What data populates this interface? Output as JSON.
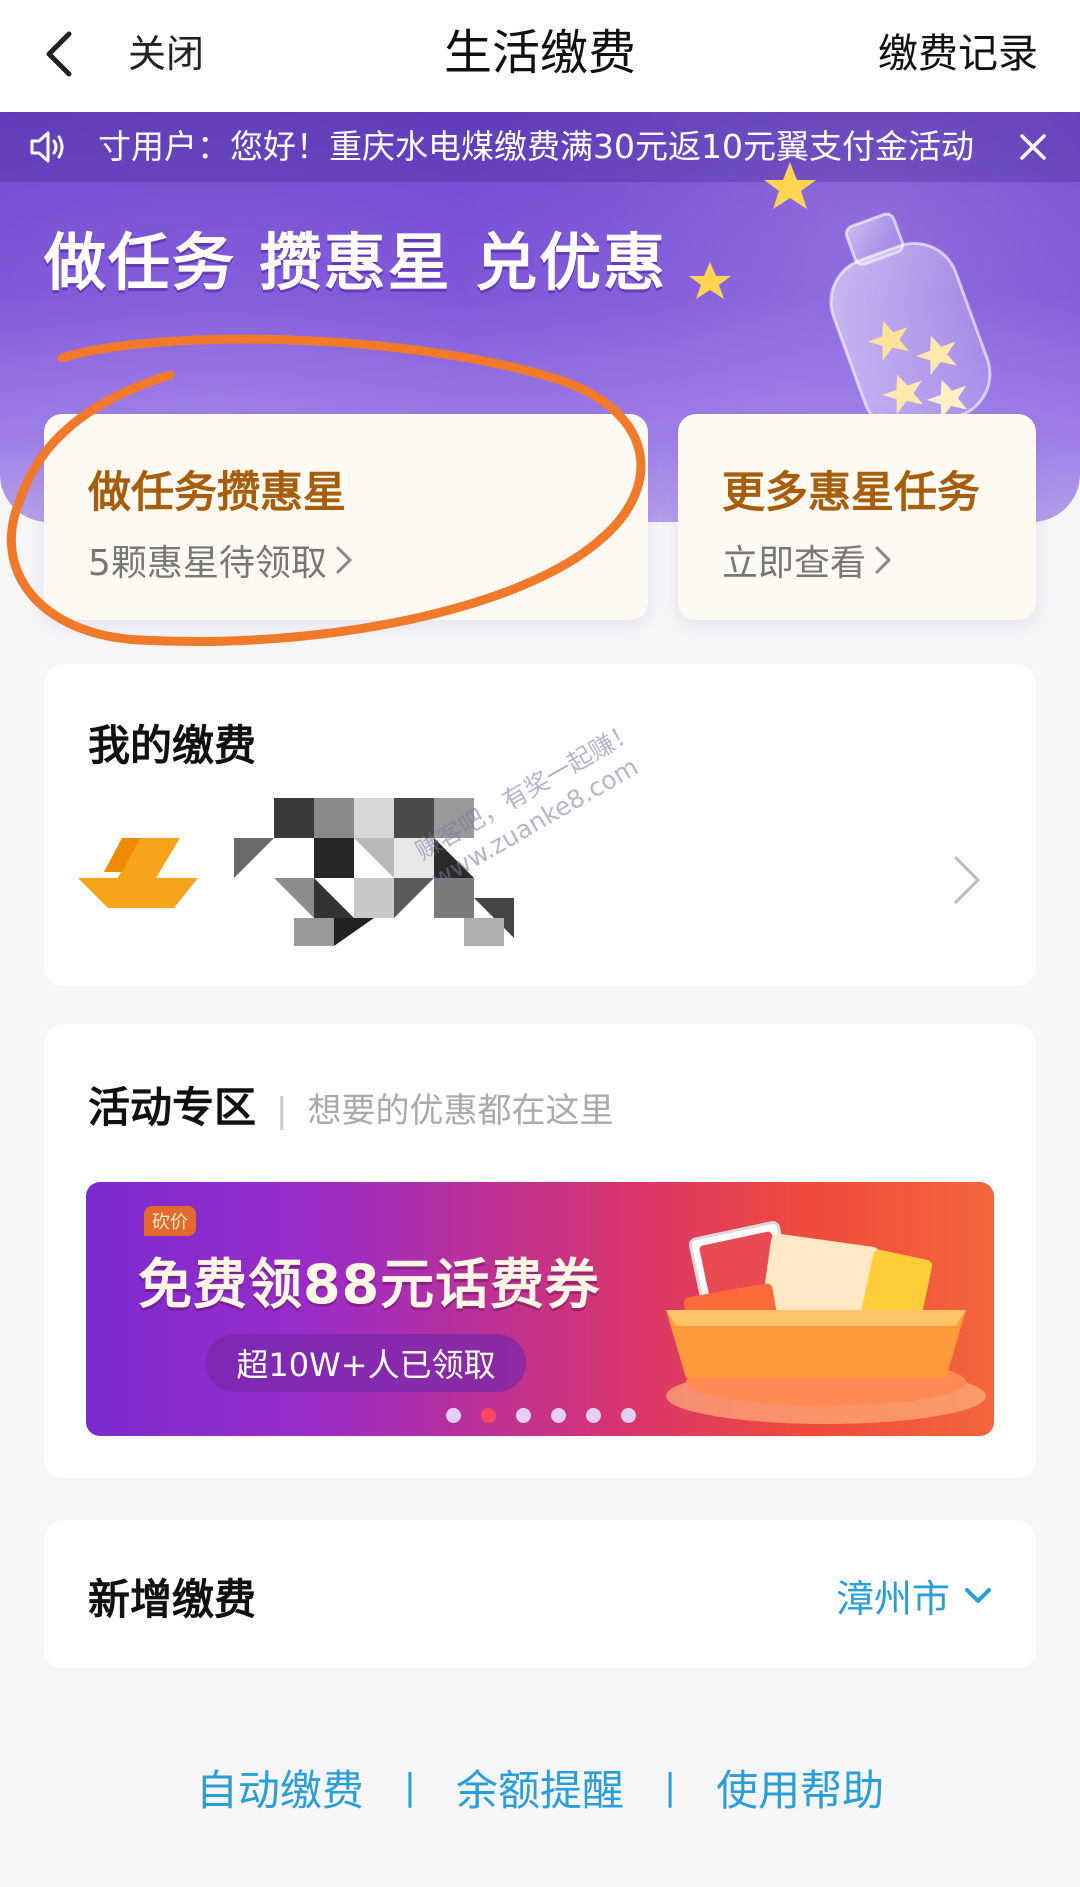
{
  "nav": {
    "back_icon": "chevron-left-icon",
    "close_label": "关闭",
    "title": "生活缴费",
    "records_label": "缴费记录"
  },
  "notice": {
    "icon": "speaker-icon",
    "text": "寸用户：您好！重庆水电煤缴费满30元返10元翼支付金活动",
    "close_icon": "close-icon"
  },
  "hero": {
    "headline": "做任务 攒惠星 兑优惠"
  },
  "task_cards": [
    {
      "title": "做任务攒惠星",
      "subtitle": "5颗惠星待领取"
    },
    {
      "title": "更多惠星任务",
      "subtitle": "立即查看"
    }
  ],
  "my_bills": {
    "title": "我的缴费"
  },
  "watermark": {
    "line1": "赚客吧，有奖一起赚！",
    "line2": "www.zuanke8.com"
  },
  "activity": {
    "title": "活动专区",
    "divider": "|",
    "subtitle": "想要的优惠都在这里",
    "banner": {
      "tag": "砍价",
      "headline": "免费领88元话费券",
      "subline": "超10W+人已领取",
      "dot_count": 6,
      "active_dot": 1
    }
  },
  "new_payment": {
    "title": "新增缴费",
    "city": "漳州市"
  },
  "footer": {
    "links": [
      "自动缴费",
      "余额提醒",
      "使用帮助"
    ],
    "separator": "|"
  },
  "colors": {
    "hero_purple": "#7a50d8",
    "task_title_brown": "#a65e0d",
    "link_blue": "#2a9ed8",
    "annotation_orange": "#f07a2a"
  }
}
